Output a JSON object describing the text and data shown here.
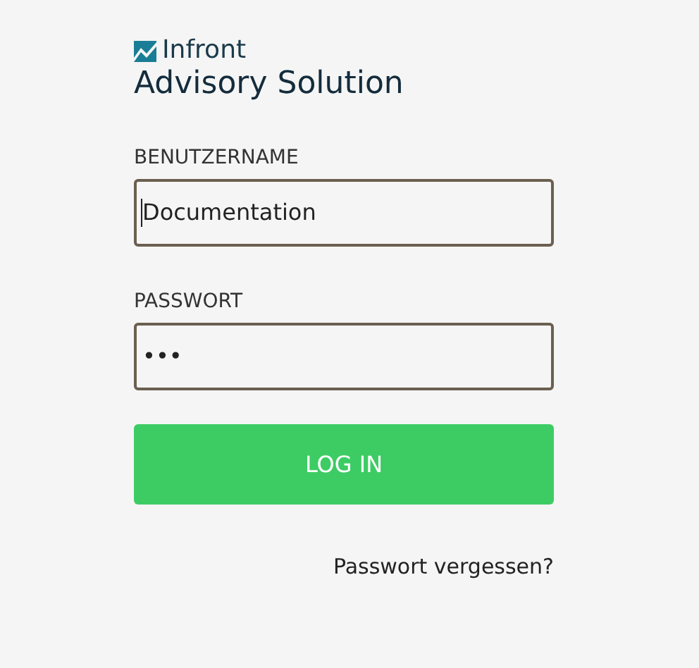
{
  "logo": {
    "brand": "Infront",
    "title": "Advisory Solution"
  },
  "fields": [
    {
      "label": "BENUTZERNAME",
      "value": "Documentation",
      "focused": true
    },
    {
      "label": "PASSWORT",
      "value": "•••",
      "focused": false
    }
  ],
  "login_button": "LOG IN",
  "forgot_link": "Passwort vergessen?"
}
